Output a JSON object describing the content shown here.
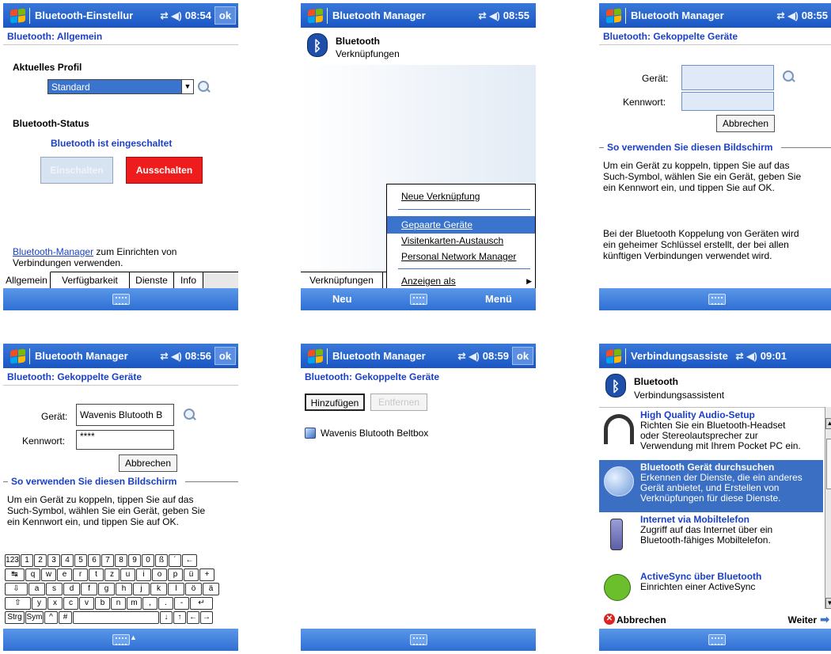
{
  "s1": {
    "title": "Bluetooth-Einstellur",
    "time": "08:54",
    "ok": "ok",
    "heading": "Bluetooth: Allgemein",
    "profile_label": "Aktuelles Profil",
    "profile_value": "Standard",
    "status_label": "Bluetooth-Status",
    "status_text": "Bluetooth ist eingeschaltet",
    "on_button": "Einschalten",
    "off_button": "Ausschalten",
    "manager_link": "Bluetooth-Manager",
    "manager_text1": " zum Einrichten von",
    "manager_text2": "Verbindungen verwenden.",
    "tabs": [
      "Allgemein",
      "Verfügbarkeit",
      "Dienste",
      "Info"
    ]
  },
  "s2": {
    "title": "Bluetooth Manager",
    "time": "08:55",
    "header_title": "Bluetooth",
    "header_sub": "Verknüpfungen",
    "menu": [
      "Neue Verknüpfung",
      "Gepaarte Geräte",
      "Visitenkarten-Austausch",
      "Personal Network Manager",
      "Anzeigen als"
    ],
    "tab": "Verknüpfungen",
    "left_soft": "Neu",
    "right_soft": "Menü"
  },
  "s3": {
    "title": "Bluetooth Manager",
    "time": "08:55",
    "heading": "Bluetooth: Gekoppelte Geräte",
    "device_label": "Gerät:",
    "password_label": "Kennwort:",
    "cancel": "Abbrechen",
    "section": "So verwenden Sie diesen Bildschirm",
    "para1": [
      "Um ein Gerät zu koppeln, tippen Sie auf das",
      "Such-Symbol, wählen Sie ein Gerät, geben Sie",
      "ein Kennwort ein, und tippen Sie auf OK."
    ],
    "para2": [
      "Bei der Bluetooth Koppelung von Geräten wird",
      "ein geheimer Schlüssel erstellt, der bei allen",
      "künftigen Verbindungen verwendet wird."
    ]
  },
  "s4": {
    "title": "Bluetooth Manager",
    "time": "08:56",
    "ok": "ok",
    "heading": "Bluetooth: Gekoppelte Geräte",
    "device_label": "Gerät:",
    "device_value": "Wavenis Blutooth B",
    "password_label": "Kennwort:",
    "password_value": "****",
    "cancel": "Abbrechen",
    "section": "So verwenden Sie diesen Bildschirm",
    "para1": [
      "Um ein Gerät zu koppeln, tippen Sie auf das",
      "Such-Symbol, wählen Sie ein Gerät, geben Sie",
      "ein Kennwort ein, und tippen Sie auf OK."
    ],
    "keyboard": {
      "row1": [
        "123",
        "1",
        "2",
        "3",
        "4",
        "5",
        "6",
        "7",
        "8",
        "9",
        "0",
        "ß",
        "´",
        "←"
      ],
      "row2": [
        "↹",
        "q",
        "w",
        "e",
        "r",
        "t",
        "z",
        "u",
        "i",
        "o",
        "p",
        "ü",
        "+"
      ],
      "row3": [
        "⇩",
        "a",
        "s",
        "d",
        "f",
        "g",
        "h",
        "j",
        "k",
        "l",
        "ö",
        "ä"
      ],
      "row4": [
        "⇧",
        "y",
        "x",
        "c",
        "v",
        "b",
        "n",
        "m",
        ",",
        ".",
        "-",
        "↵"
      ],
      "row5": [
        "Strg",
        "Sym",
        "^",
        "#",
        "",
        "↓",
        "↑",
        "←",
        "→"
      ]
    }
  },
  "s5": {
    "title": "Bluetooth Manager",
    "time": "08:59",
    "ok": "ok",
    "heading": "Bluetooth: Gekoppelte Geräte",
    "add": "Hinzufügen",
    "remove": "Entfernen",
    "device": "Wavenis Blutooth Beltbox"
  },
  "s6": {
    "title": "Verbindungsassiste",
    "time": "09:01",
    "header_title": "Bluetooth",
    "header_sub": "Verbindungsassistent",
    "items": [
      {
        "title": "High Quality Audio-Setup",
        "desc": [
          "Richten Sie ein Bluetooth-Headset",
          "oder Stereolautsprecher zur",
          "Verwendung mit Ihrem Pocket PC ein."
        ]
      },
      {
        "title": "Bluetooth Gerät durchsuchen",
        "desc": [
          "Erkennen der Dienste, die ein anderes",
          "Gerät anbietet, und Erstellen von",
          "Verknüpfungen für diese Dienste."
        ]
      },
      {
        "title": "Internet via Mobiltelefon",
        "desc": [
          "Zugriff auf das Internet über ein",
          "Bluetooth-fähiges Mobiltelefon."
        ]
      },
      {
        "title": "ActiveSync über Bluetooth",
        "desc": [
          "Einrichten einer ActiveSync"
        ]
      }
    ],
    "cancel": "Abbrechen",
    "next": "Weiter"
  }
}
